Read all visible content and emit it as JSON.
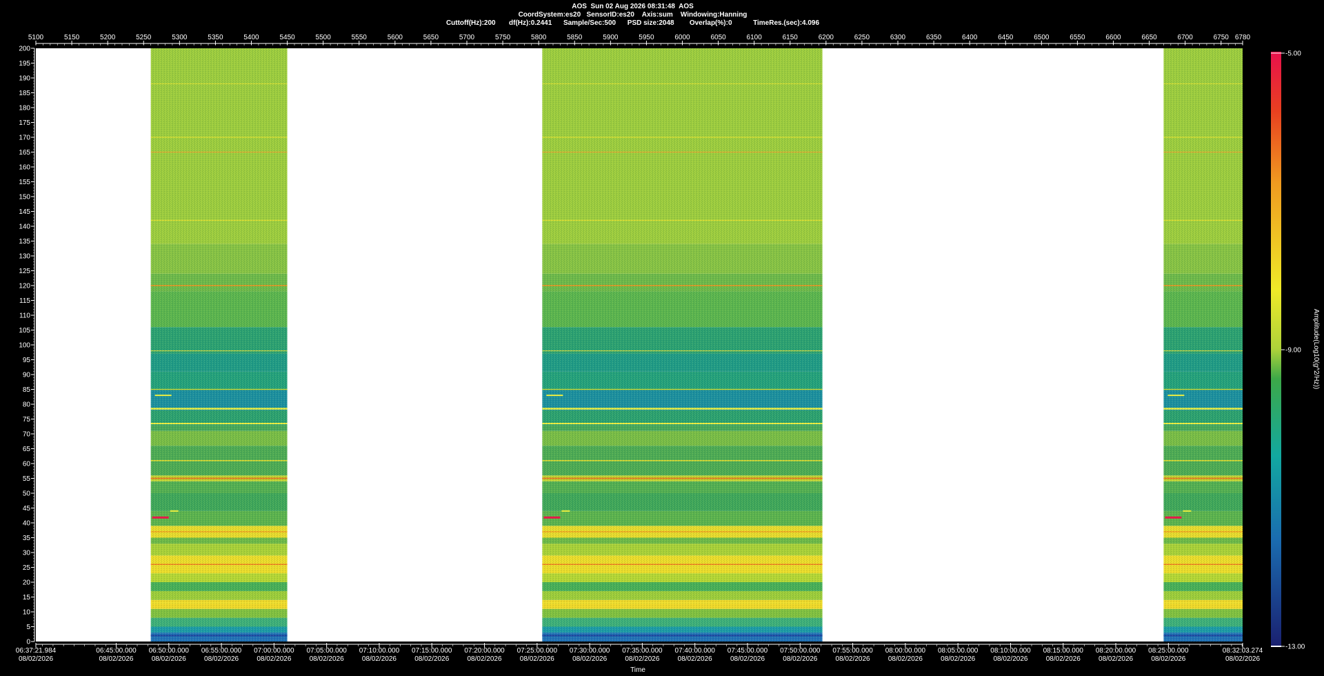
{
  "header": {
    "line1": "AOS  Sun 02 Aug 2026 08:31:48  AOS",
    "line2": "CoordSystem:es20   SensorID:es20    Axis:sum    Windowing:Hanning",
    "line3": "Cuttoff(Hz):200       df(Hz):0.2441      Sample/Sec:500      PSD size:2048        Overlap(%):0           TimeRes.(sec):4.096"
  },
  "chart_data": {
    "type": "heatmap",
    "title": "",
    "xlabel": "Time",
    "ylabel": "",
    "colorbar_label": "Amplitude(Log10(g^2/Hz))",
    "colorbar_ticks": [
      "-5.00",
      "-9.00",
      "-13.00"
    ],
    "colorbar_range": [
      -13,
      -5
    ],
    "ylim": [
      0,
      200
    ],
    "y_ticks": [
      0,
      5,
      10,
      15,
      20,
      25,
      30,
      35,
      40,
      45,
      50,
      55,
      60,
      65,
      70,
      75,
      80,
      85,
      90,
      95,
      100,
      105,
      110,
      115,
      120,
      125,
      130,
      135,
      140,
      145,
      150,
      155,
      160,
      165,
      170,
      175,
      180,
      185,
      190,
      195,
      200
    ],
    "top_axis": {
      "range": [
        5100,
        6780
      ],
      "ticks": [
        5100,
        5150,
        5200,
        5250,
        5300,
        5350,
        5400,
        5450,
        5500,
        5550,
        5600,
        5650,
        5700,
        5750,
        5800,
        5850,
        5900,
        5950,
        6000,
        6050,
        6100,
        6150,
        6200,
        6250,
        6300,
        6350,
        6400,
        6450,
        6500,
        6550,
        6600,
        6650,
        6700,
        6750,
        6780
      ]
    },
    "bottom_axis": {
      "start": "06:37:21.984",
      "end": "08:32:03.274",
      "date": "08/02/2026",
      "ticks": [
        "06:37:21.984",
        "06:45:00.000",
        "06:50:00.000",
        "06:55:00.000",
        "07:00:00.000",
        "07:05:00.000",
        "07:10:00.000",
        "07:15:00.000",
        "07:20:00.000",
        "07:25:00.000",
        "07:30:00.000",
        "07:35:00.000",
        "07:40:00.000",
        "07:45:00.000",
        "07:50:00.000",
        "07:55:00.000",
        "08:00:00.000",
        "08:05:00.000",
        "08:10:00.000",
        "08:15:00.000",
        "08:20:00.000",
        "08:25:00.000",
        "08:32:03.274"
      ]
    },
    "data_segments": [
      {
        "start": 5260,
        "end": 5450
      },
      {
        "start": 5805,
        "end": 6195
      },
      {
        "start": 6670,
        "end": 6780
      }
    ],
    "colors": {
      "low": "#1a2a8c",
      "midlow": "#12a0a0",
      "mid": "#52b040",
      "midhigh": "#e8e82a",
      "high": "#f08020",
      "max": "#e8104c"
    }
  }
}
